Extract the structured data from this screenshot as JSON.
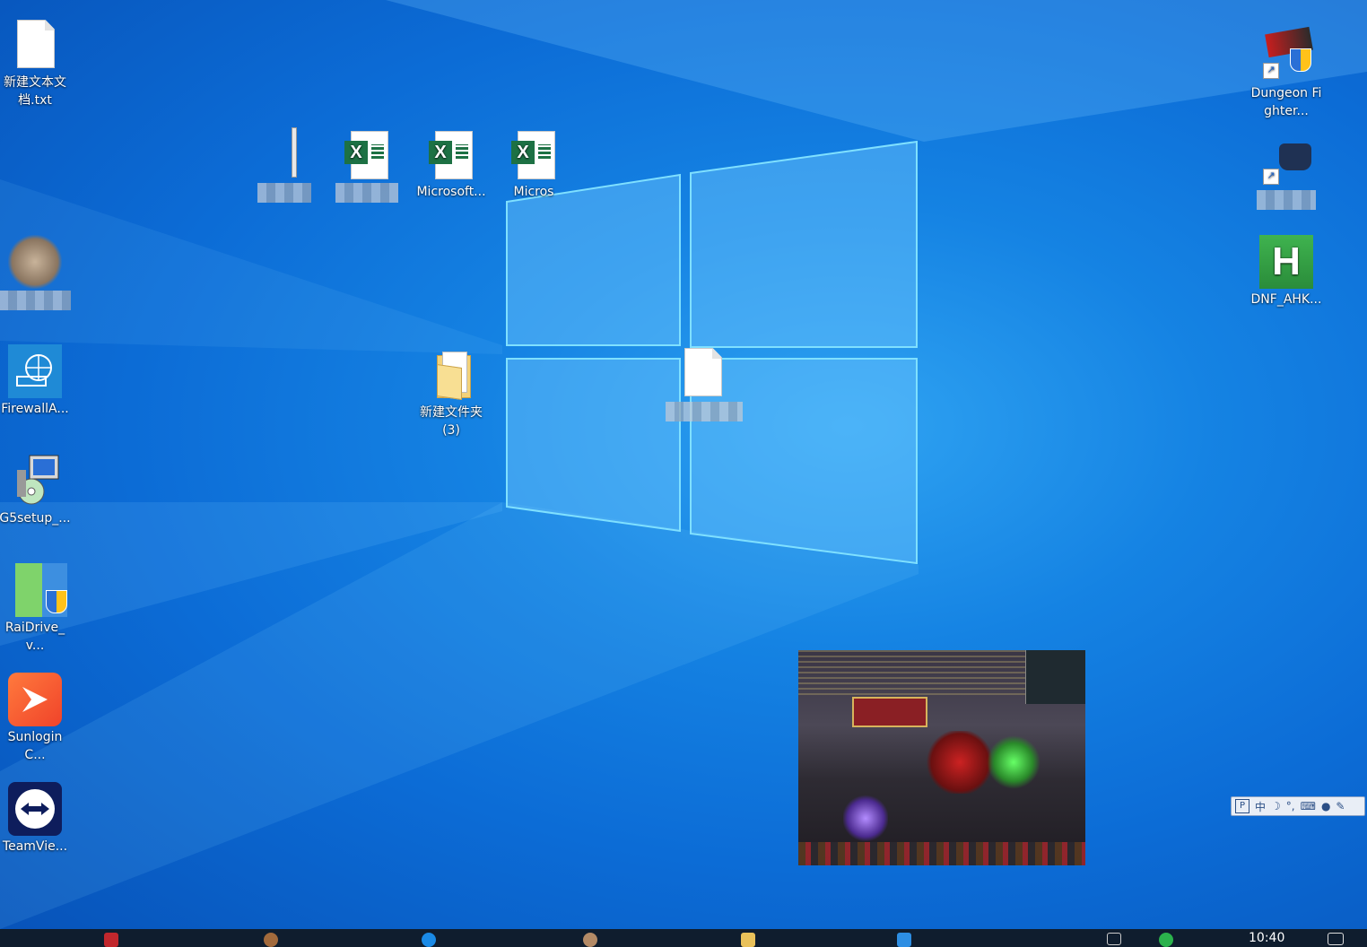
{
  "desktop": {
    "icons": [
      {
        "label": "新建文本文档.txt",
        "type": "text-file"
      },
      {
        "label": "",
        "type": "obscured"
      },
      {
        "label": "FirewallA...",
        "type": "firewall-app"
      },
      {
        "label": "G5setup_...",
        "type": "installer"
      },
      {
        "label": "RaiDrive_v...",
        "type": "raidrive"
      },
      {
        "label": "SunloginC...",
        "type": "sunlogin"
      },
      {
        "label": "TeamVie...",
        "type": "teamviewer"
      },
      {
        "label": "",
        "type": "obscured-file"
      },
      {
        "label": "",
        "type": "excel-obscured"
      },
      {
        "label": "Microsoft...",
        "type": "excel"
      },
      {
        "label": "Micros",
        "type": "excel"
      },
      {
        "label": "新建文件夹 (3)",
        "type": "folder"
      },
      {
        "label": "",
        "type": "blank-file-obscured"
      },
      {
        "label": "Dungeon Fighter...",
        "type": "game-shortcut"
      },
      {
        "label": "W...",
        "type": "obscured-shortcut"
      },
      {
        "label": "DNF_AHK...",
        "type": "ahk-script"
      }
    ]
  },
  "ime": {
    "lang": "中",
    "items": [
      "moon-icon",
      "punct-icon",
      "keyboard-icon",
      "user-icon",
      "wrench-icon"
    ]
  },
  "taskbar": {
    "clock": "10:40",
    "items": [
      "pdf-app",
      "avatar-app",
      "browser-app",
      "avatar-app-2",
      "folder-app",
      "store-app"
    ]
  }
}
